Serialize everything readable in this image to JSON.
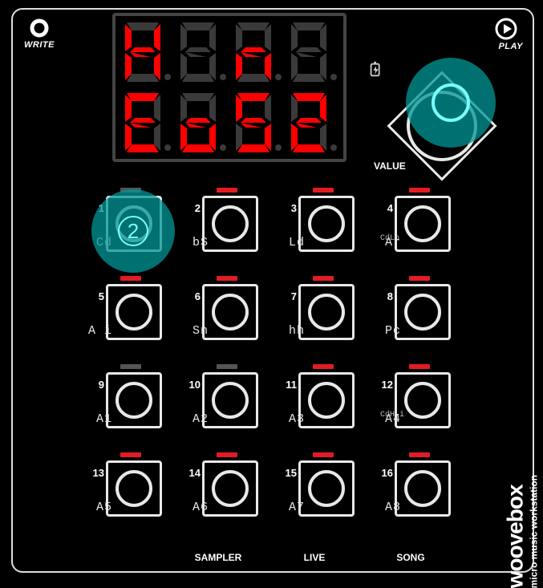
{
  "corner": {
    "write_label": "WRITE",
    "play_label": "PLAY"
  },
  "value_label": "VALUE",
  "seven_seg": {
    "row1": [
      "H",
      " ",
      "n",
      " "
    ],
    "row2": [
      "E",
      "o",
      "5",
      "2"
    ],
    "row2_alt": [
      "L",
      "o",
      "5",
      "2"
    ]
  },
  "pads": [
    {
      "n": "1",
      "sub": "Cd",
      "chord": "",
      "led": "gry"
    },
    {
      "n": "2",
      "sub": "bS",
      "chord": "",
      "led": "red"
    },
    {
      "n": "3",
      "sub": "Ld",
      "chord": "",
      "led": "red"
    },
    {
      "n": "4",
      "sub": "Ar",
      "chord": "CdLo",
      "led": "red"
    },
    {
      "n": "5",
      "sub": "A i",
      "chord": "",
      "led": "red"
    },
    {
      "n": "6",
      "sub": "Sn",
      "chord": "",
      "led": "red"
    },
    {
      "n": "7",
      "sub": "hh",
      "chord": "",
      "led": "red"
    },
    {
      "n": "8",
      "sub": "Pc",
      "chord": "",
      "led": "red"
    },
    {
      "n": "9",
      "sub": "A1",
      "chord": "",
      "led": "gry"
    },
    {
      "n": "10",
      "sub": "A2",
      "chord": "",
      "led": "gry"
    },
    {
      "n": "11",
      "sub": "A3",
      "chord": "",
      "led": "red"
    },
    {
      "n": "12",
      "sub": "A4",
      "chord": "CdH i",
      "led": "red"
    },
    {
      "n": "13",
      "sub": "A5",
      "chord": "",
      "led": "red"
    },
    {
      "n": "14",
      "sub": "A6",
      "chord": "",
      "led": "red"
    },
    {
      "n": "15",
      "sub": "A7",
      "chord": "",
      "led": "red"
    },
    {
      "n": "16",
      "sub": "A8",
      "chord": "",
      "led": "red"
    }
  ],
  "modes": {
    "c1": "",
    "c2": "SAMPLER",
    "c3": "LIVE",
    "c4": "SONG"
  },
  "brand": {
    "big": "woovebox",
    "small": "micro music workstation"
  },
  "highlights": {
    "step_on_pad1": "2"
  }
}
